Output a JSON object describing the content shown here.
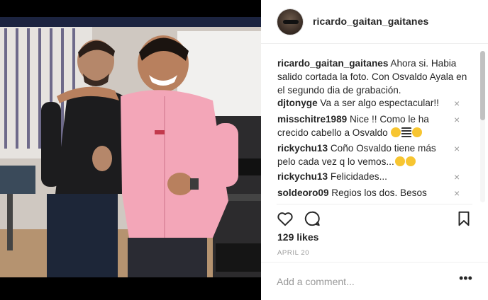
{
  "post": {
    "username": "ricardo_gaitan_gaitanes",
    "caption_user": "ricardo_gaitan_gaitanes",
    "caption_text": " Ahora si. Habia salido cortada la foto. Con Osvaldo Ayala en el segundo dia de grabación."
  },
  "comments": [
    {
      "user": "djtonyge",
      "text": " Va a ser algo espectacular!!",
      "emoji": []
    },
    {
      "user": "misschitre1989",
      "text": " Nice !! Como le ha crecido cabello a Osvaldo ",
      "emoji": [
        "smile",
        "flag",
        "kiss"
      ]
    },
    {
      "user": "rickychu13",
      "text": " Coño Osvaldo tiene más pelo cada vez q lo vemos...",
      "emoji": [
        "smile",
        "smile"
      ]
    },
    {
      "user": "rickychu13",
      "text": " Felicidades...",
      "emoji": []
    },
    {
      "user": "soldeoro09",
      "text": " Regios los dos. Besos",
      "emoji": []
    }
  ],
  "close_glyph": "×",
  "likes": "129 likes",
  "date": "APRIL 20",
  "add_comment_placeholder": "Add a comment...",
  "more_glyph": "•••",
  "icons": {
    "like": "heart-icon",
    "comment": "comment-icon",
    "save": "bookmark-icon"
  },
  "colors": {
    "text": "#262626",
    "muted": "#999999",
    "border": "#efefef",
    "shirt": "#f3a6b8"
  }
}
